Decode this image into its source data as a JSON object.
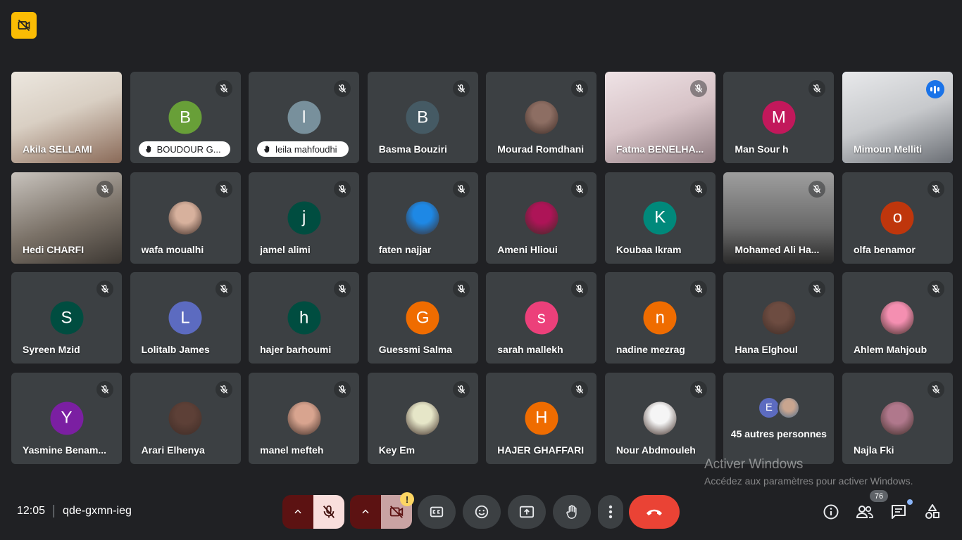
{
  "recording_badge": {
    "color": "#fbbc04"
  },
  "participants": [
    {
      "name": "Akila SELLAMI",
      "type": "video",
      "muted": false,
      "bg": "linear-gradient(160deg,#ece7df 0%,#d9cfc3 45%,#8a6a58 100%)"
    },
    {
      "name": "BOUDOUR G...",
      "type": "avatar",
      "initial": "B",
      "color": "#689f38",
      "muted": true,
      "pill": true
    },
    {
      "name": "leila mahfoudhi",
      "type": "avatar",
      "initial": "l",
      "color": "#78909c",
      "muted": true,
      "pill": true
    },
    {
      "name": "Basma Bouziri",
      "type": "avatar",
      "initial": "B",
      "color": "#455a64",
      "muted": true
    },
    {
      "name": "Mourad Romdhani",
      "type": "photo",
      "color": "#8d6e63",
      "muted": true
    },
    {
      "name": "Fatma BENELHA...",
      "type": "video",
      "muted": true,
      "bg": "linear-gradient(160deg,#efe3e6 0%,#d7c3c7 50%,#8e7b80 100%)"
    },
    {
      "name": "Man Sour h",
      "type": "avatar",
      "initial": "M",
      "color": "#c2185b",
      "muted": true
    },
    {
      "name": "Mimoun Melliti",
      "type": "video",
      "muted": false,
      "speaking": true,
      "bg": "linear-gradient(160deg,#e8e9eb 0%,#c7c9cc 50%,#6b6f75 100%)"
    },
    {
      "name": "Hedi CHARFI",
      "type": "video",
      "muted": true,
      "bg": "linear-gradient(160deg,#c8c3bd 0%,#7a7167 55%,#3d3833 100%)"
    },
    {
      "name": "wafa moualhi",
      "type": "photo",
      "color": "#d7b19d",
      "muted": true
    },
    {
      "name": "jamel alimi",
      "type": "avatar",
      "initial": "j",
      "color": "#004d40",
      "muted": true
    },
    {
      "name": "faten najjar",
      "type": "photo",
      "color": "#1e88e5",
      "muted": true
    },
    {
      "name": "Ameni Hlioui",
      "type": "photo",
      "color": "#ad1457",
      "muted": true
    },
    {
      "name": "Koubaa Ikram",
      "type": "avatar",
      "initial": "K",
      "color": "#00897b",
      "muted": true
    },
    {
      "name": "Mohamed Ali Ha...",
      "type": "video",
      "muted": true,
      "bg": "linear-gradient(180deg,#9e9e9e 0%,#6a6a6a 60%,#2b2b2b 100%)"
    },
    {
      "name": "olfa benamor",
      "type": "avatar",
      "initial": "o",
      "color": "#bf360c",
      "muted": true
    },
    {
      "name": "Syreen Mzid",
      "type": "avatar",
      "initial": "S",
      "color": "#004d40",
      "muted": true
    },
    {
      "name": "Lolitalb James",
      "type": "avatar",
      "initial": "L",
      "color": "#5c6bc0",
      "muted": true
    },
    {
      "name": "hajer barhoumi",
      "type": "avatar",
      "initial": "h",
      "color": "#004d40",
      "muted": true
    },
    {
      "name": "Guessmi Salma",
      "type": "avatar",
      "initial": "G",
      "color": "#ef6c00",
      "muted": true
    },
    {
      "name": "sarah mallekh",
      "type": "avatar",
      "initial": "s",
      "color": "#ec407a",
      "muted": true
    },
    {
      "name": "nadine mezrag",
      "type": "avatar",
      "initial": "n",
      "color": "#ef6c00",
      "muted": true
    },
    {
      "name": "Hana Elghoul",
      "type": "photo",
      "color": "#6d4c41",
      "muted": true
    },
    {
      "name": "Ahlem Mahjoub",
      "type": "photo",
      "color": "#f48fb1",
      "muted": true
    },
    {
      "name": "Yasmine Benam...",
      "type": "avatar",
      "initial": "Y",
      "color": "#7b1fa2",
      "muted": true
    },
    {
      "name": "Arari Elhenya",
      "type": "photo",
      "color": "#5d4037",
      "muted": true
    },
    {
      "name": "manel mefteh",
      "type": "photo",
      "color": "#d8a48f",
      "muted": true
    },
    {
      "name": "Key Em",
      "type": "photo",
      "color": "#e6e6c8",
      "muted": true
    },
    {
      "name": "HAJER GHAFFARI",
      "type": "avatar",
      "initial": "H",
      "color": "#ef6c00",
      "muted": true
    },
    {
      "name": "Nour Abdmouleh",
      "type": "photo",
      "color": "#f5f5f5",
      "muted": true
    },
    {
      "name": "45 autres personnes",
      "type": "others",
      "initial": "E",
      "color": "#5c6bc0",
      "muted": false
    },
    {
      "name": "Najla Fki",
      "type": "photo",
      "color": "#b0788c",
      "muted": true
    }
  ],
  "windows_activation": {
    "title": "Activer Windows",
    "subtitle": "Accédez aux paramètres pour activer Windows."
  },
  "meeting": {
    "time": "12:05",
    "code": "qde-gxmn-ieg"
  },
  "controls": {
    "warning_symbol": "!",
    "participants_count": "76",
    "danger_color": "#ea4335",
    "accent_color": "#8ab4f8"
  }
}
